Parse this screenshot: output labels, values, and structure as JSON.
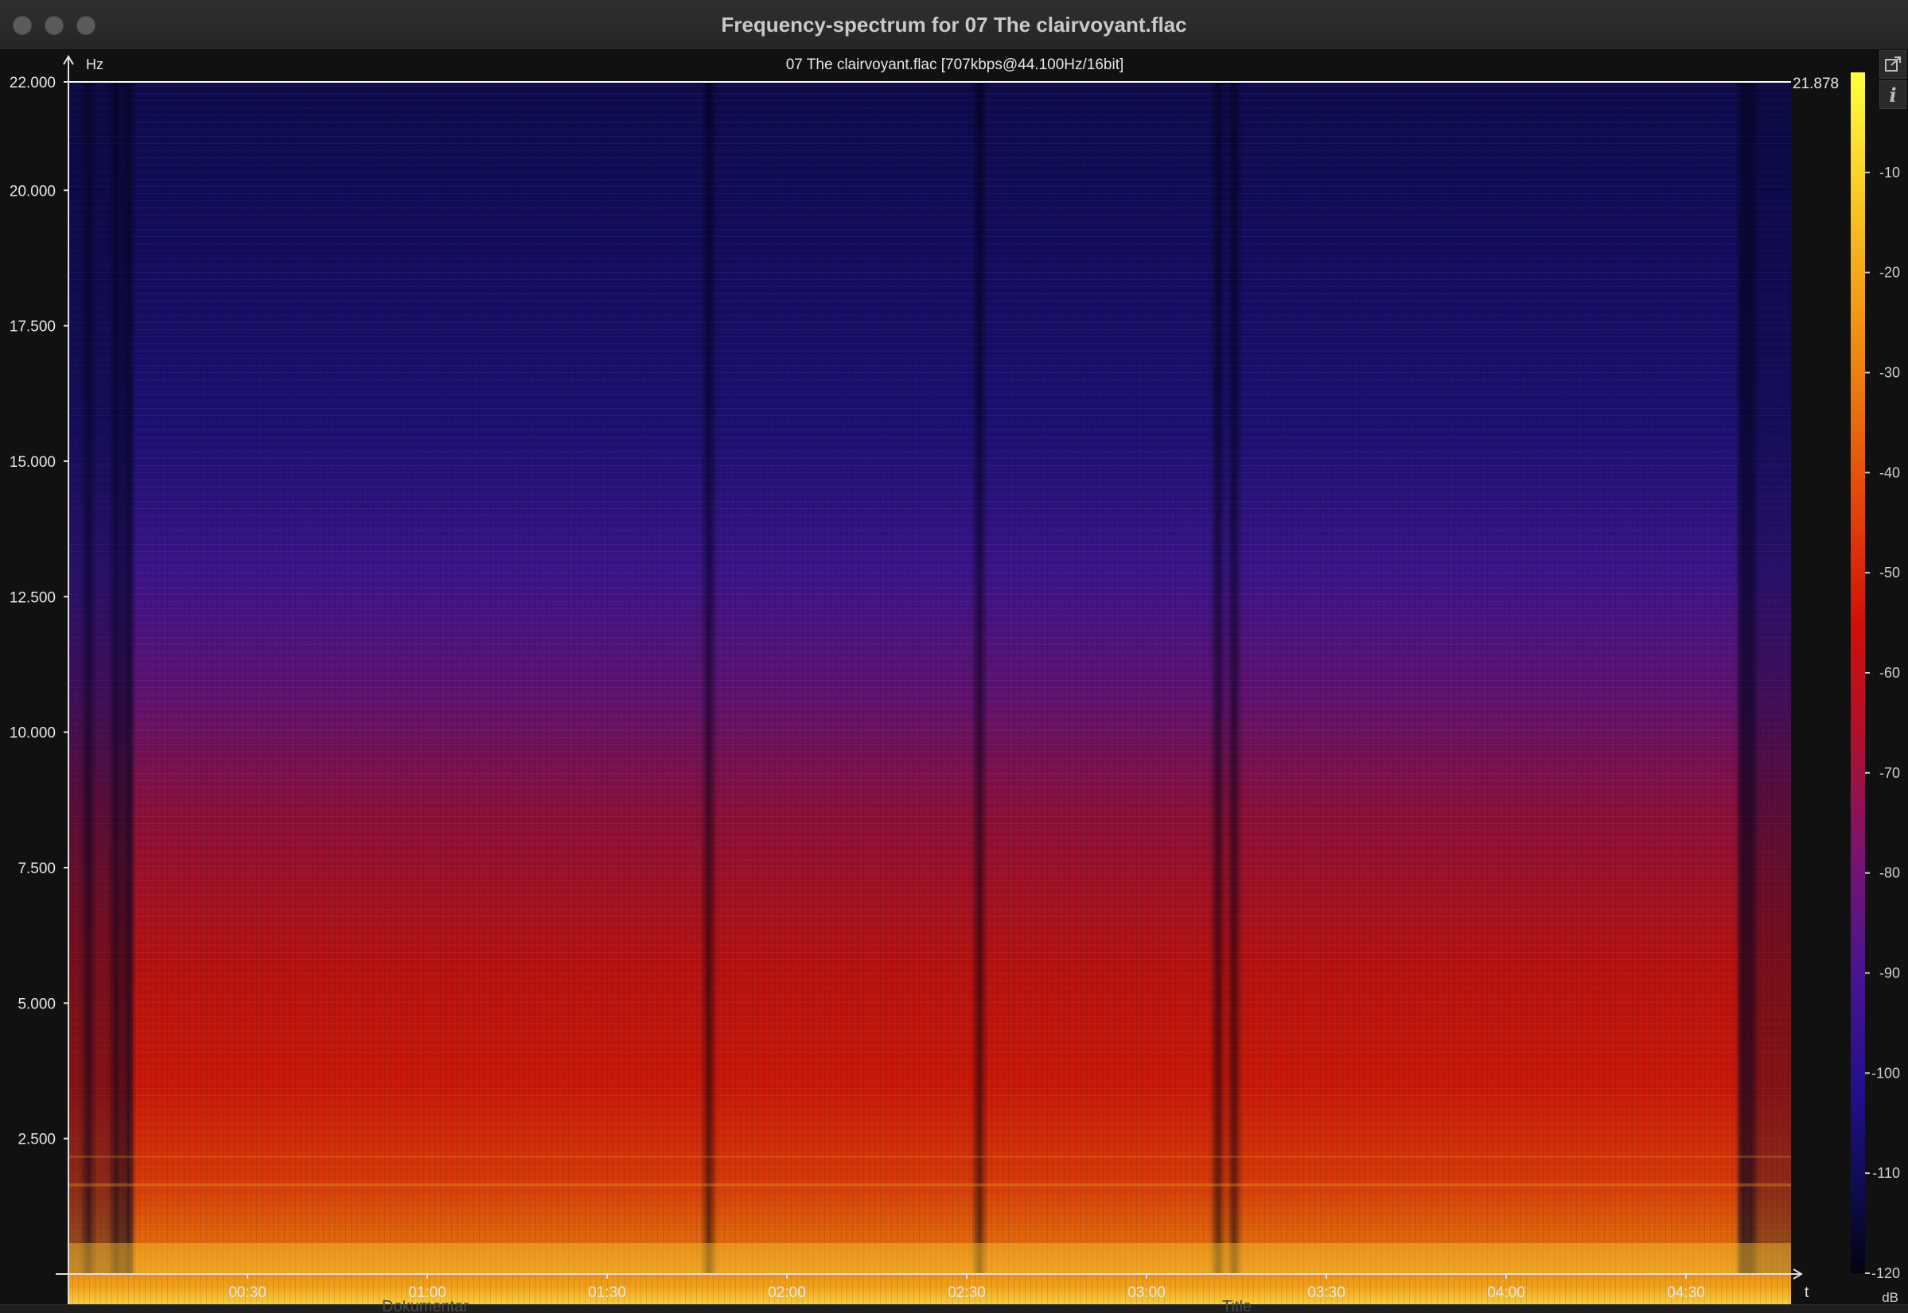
{
  "window": {
    "title": "Frequency-spectrum for 07 The clairvoyant.flac",
    "buttons": [
      "close",
      "minimize",
      "zoom"
    ]
  },
  "spectrum": {
    "file_info": "07 The clairvoyant.flac [707kbps@44.100Hz/16bit]",
    "max_freq_label": "21.878",
    "y_axis_unit": "Hz",
    "x_axis_unit": "t",
    "y_ticks": [
      "22.000",
      "20.000",
      "17.500",
      "15.000",
      "12.500",
      "10.000",
      "7.500",
      "5.000",
      "2.500"
    ],
    "x_ticks": [
      "00:30",
      "01:00",
      "01:30",
      "02:00",
      "02:30",
      "03:00",
      "03:30",
      "04:00",
      "04:30"
    ],
    "colorbar_ticks": [
      "-10",
      "-20",
      "-30",
      "-40",
      "-50",
      "-60",
      "-70",
      "-80",
      "-90",
      "-100",
      "-110",
      "-120"
    ],
    "colorbar_unit": "dB",
    "colors": {
      "low": "#06061e",
      "mid_blue": "#1a1080",
      "purple": "#5a1490",
      "red": "#c81208",
      "orange": "#e87a10",
      "high": "#ffff30"
    }
  },
  "side_icons": [
    "external-window-icon",
    "info-icon"
  ],
  "background_hints": {
    "left_text": "Dokumentar",
    "right_text": "Title"
  },
  "chart_data": {
    "type": "heatmap",
    "title": "07 The clairvoyant.flac [707kbps@44.100Hz/16bit]",
    "xlabel": "t",
    "ylabel": "Hz",
    "x_ticks": [
      "00:30",
      "01:00",
      "01:30",
      "02:00",
      "02:30",
      "03:00",
      "03:30",
      "04:00",
      "04:30"
    ],
    "y_ticks": [
      22000,
      20000,
      17500,
      15000,
      12500,
      10000,
      7500,
      5000,
      2500
    ],
    "ylim": [
      0,
      22000
    ],
    "colorbar": {
      "unit": "dB",
      "range": [
        -120,
        0
      ]
    },
    "max_frequency_marker": 21878
  }
}
